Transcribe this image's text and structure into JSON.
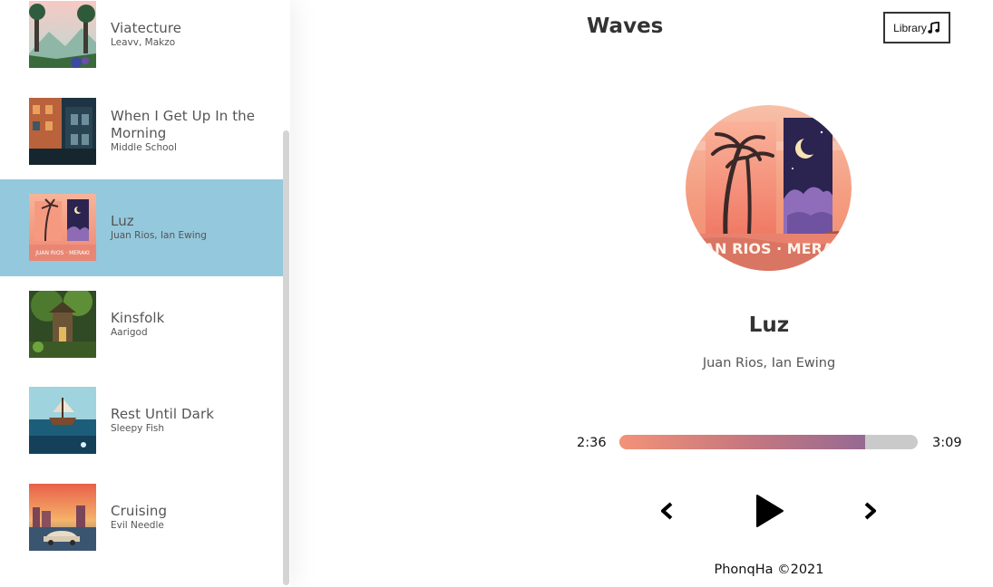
{
  "header": {
    "title": "Waves",
    "library_button_label": "Library"
  },
  "library": {
    "songs": [
      {
        "title": "Viatecture",
        "artist": "Leavv, Makzo",
        "active": false
      },
      {
        "title": "When I Get Up In the Morning",
        "artist": "Middle School",
        "active": false
      },
      {
        "title": "Luz",
        "artist": "Juan Rios, Ian Ewing",
        "active": true
      },
      {
        "title": "Kinsfolk",
        "artist": "Aarigod",
        "active": false
      },
      {
        "title": "Rest Until Dark",
        "artist": "Sleepy Fish",
        "active": false
      },
      {
        "title": "Cruising",
        "artist": "Evil Needle",
        "active": false
      }
    ]
  },
  "player": {
    "song_title": "Luz",
    "song_artist": "Juan Rios, Ian Ewing",
    "current_time": "2:36",
    "total_time": "3:09",
    "progress_percent": 82.5,
    "cover_text": "JUAN RIOS · MERAKI"
  },
  "footer": {
    "text": "PhonqHa ©2021"
  },
  "colors": {
    "active_row": "#94c8dc",
    "gradient_start": "#f39278",
    "gradient_end": "#966a93",
    "track_bg": "#cacaca"
  }
}
